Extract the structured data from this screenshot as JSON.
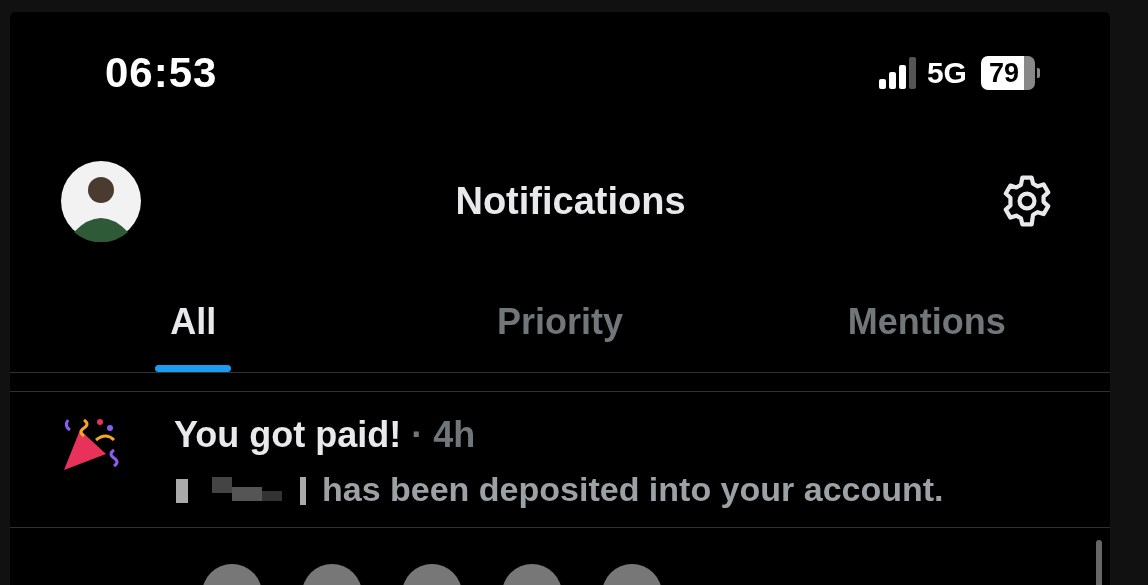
{
  "status_bar": {
    "time": "06:53",
    "network": "5G",
    "battery": "79"
  },
  "header": {
    "title": "Notifications"
  },
  "tabs": [
    {
      "label": "All",
      "selected": true
    },
    {
      "label": "Priority",
      "selected": false
    },
    {
      "label": "Mentions",
      "selected": false
    }
  ],
  "notifications": [
    {
      "title": "You got paid!",
      "time": "· 4h",
      "body": "has been deposited into your account."
    }
  ]
}
